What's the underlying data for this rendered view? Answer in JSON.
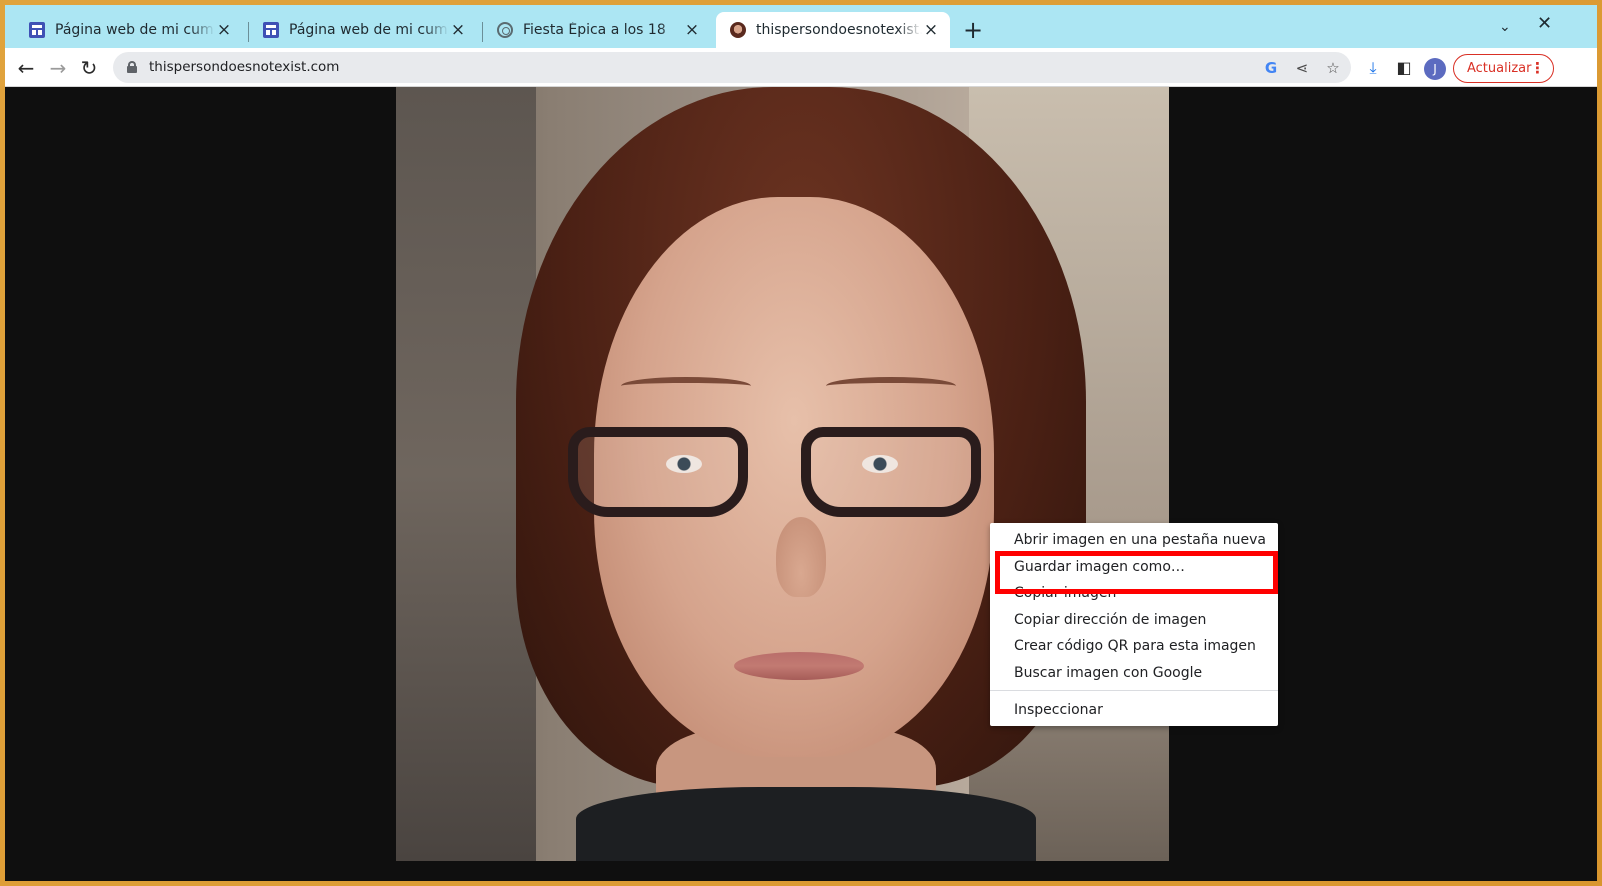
{
  "tabs": [
    {
      "title": "Página web de mi cumpleaños",
      "favicon": "doc-icon",
      "active": false
    },
    {
      "title": "Página web de mi cumpleaños",
      "favicon": "doc-icon",
      "active": false
    },
    {
      "title": "Fiesta Épica a los 18",
      "favicon": "chatgpt-icon",
      "active": false
    },
    {
      "title": "thispersondoesnotexist.com",
      "favicon": "face-icon",
      "active": true
    }
  ],
  "tab_controls": {
    "new_tab": "+",
    "tab_search": "⌄",
    "close_window": "✕"
  },
  "toolbar": {
    "back": "←",
    "forward": "→",
    "reload": "↻",
    "url": "thispersondoesnotexist.com",
    "google_lens": "G",
    "share": "⋖",
    "bookmark": "☆",
    "download": "⤓",
    "side_panel": "◧",
    "profile_initial": "J",
    "update_label": "Actualizar",
    "menu": "⋮"
  },
  "context_menu": {
    "items": [
      "Abrir imagen en una pestaña nueva",
      "Guardar imagen como…",
      "Copiar imagen",
      "Copiar dirección de imagen",
      "Crear código QR para esta imagen",
      "Buscar imagen con Google",
      "Inspeccionar"
    ],
    "highlighted_item": "Guardar imagen como…",
    "highlight_color": "#ff0000"
  },
  "colors": {
    "tabstrip": "#ace6f3",
    "accent": "#1a73e8",
    "update": "#d93025",
    "desktop": "#e0a33c"
  }
}
